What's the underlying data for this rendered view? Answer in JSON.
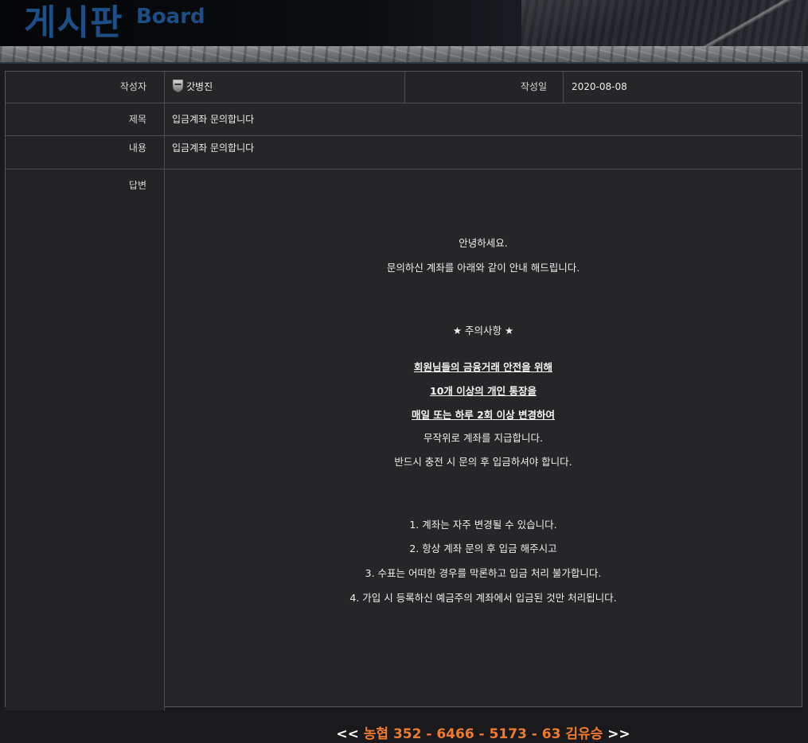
{
  "banner": {
    "title": "게시판",
    "subtitle": "Board"
  },
  "post": {
    "author_label": "작성자",
    "author": "갓병진",
    "date_label": "작성일",
    "date": "2020-08-08",
    "subject_label": "제목",
    "subject": "입금계좌 문의합니다",
    "content_label": "내용",
    "content": "입금계좌 문의합니다",
    "reply_label": "답변"
  },
  "reply": {
    "greeting": "안녕하세요.",
    "intro": "문의하신 계좌를 아래와 같이 안내 해드립니다.",
    "notice_title": "★  주의사항  ★",
    "notice_bold": [
      "회원님들의 금융거래 안전을 위해",
      "10개 이상의 개인 통장을",
      "매일 또는 하루 2회 이상 변경하여"
    ],
    "notice_lines": [
      "무작위로 계좌를 지급합니다.",
      "반드시 충전 시 문의 후 입금하셔야 합니다."
    ],
    "rules": [
      "1. 계좌는 자주 변경될 수 있습니다.",
      "2. 항상 계좌 문의 후 입금 해주시고",
      "3. 수표는 어떠한 경우를 막론하고 입금 처리 불가합니다.",
      "4. 가입 시 등록하신 예금주의 계좌에서 입금된 것만 처리됩니다."
    ],
    "account_open": "<<",
    "account": "농협 352 - 6466 - 5173 - 63 김유승",
    "account_close": ">>"
  },
  "colors": {
    "background": "#1a1a1c",
    "board": "#262629",
    "title_blue": "#1d4f86",
    "account_orange": "#f07a2e"
  },
  "icons": {
    "author_level": "level-shield-icon"
  }
}
